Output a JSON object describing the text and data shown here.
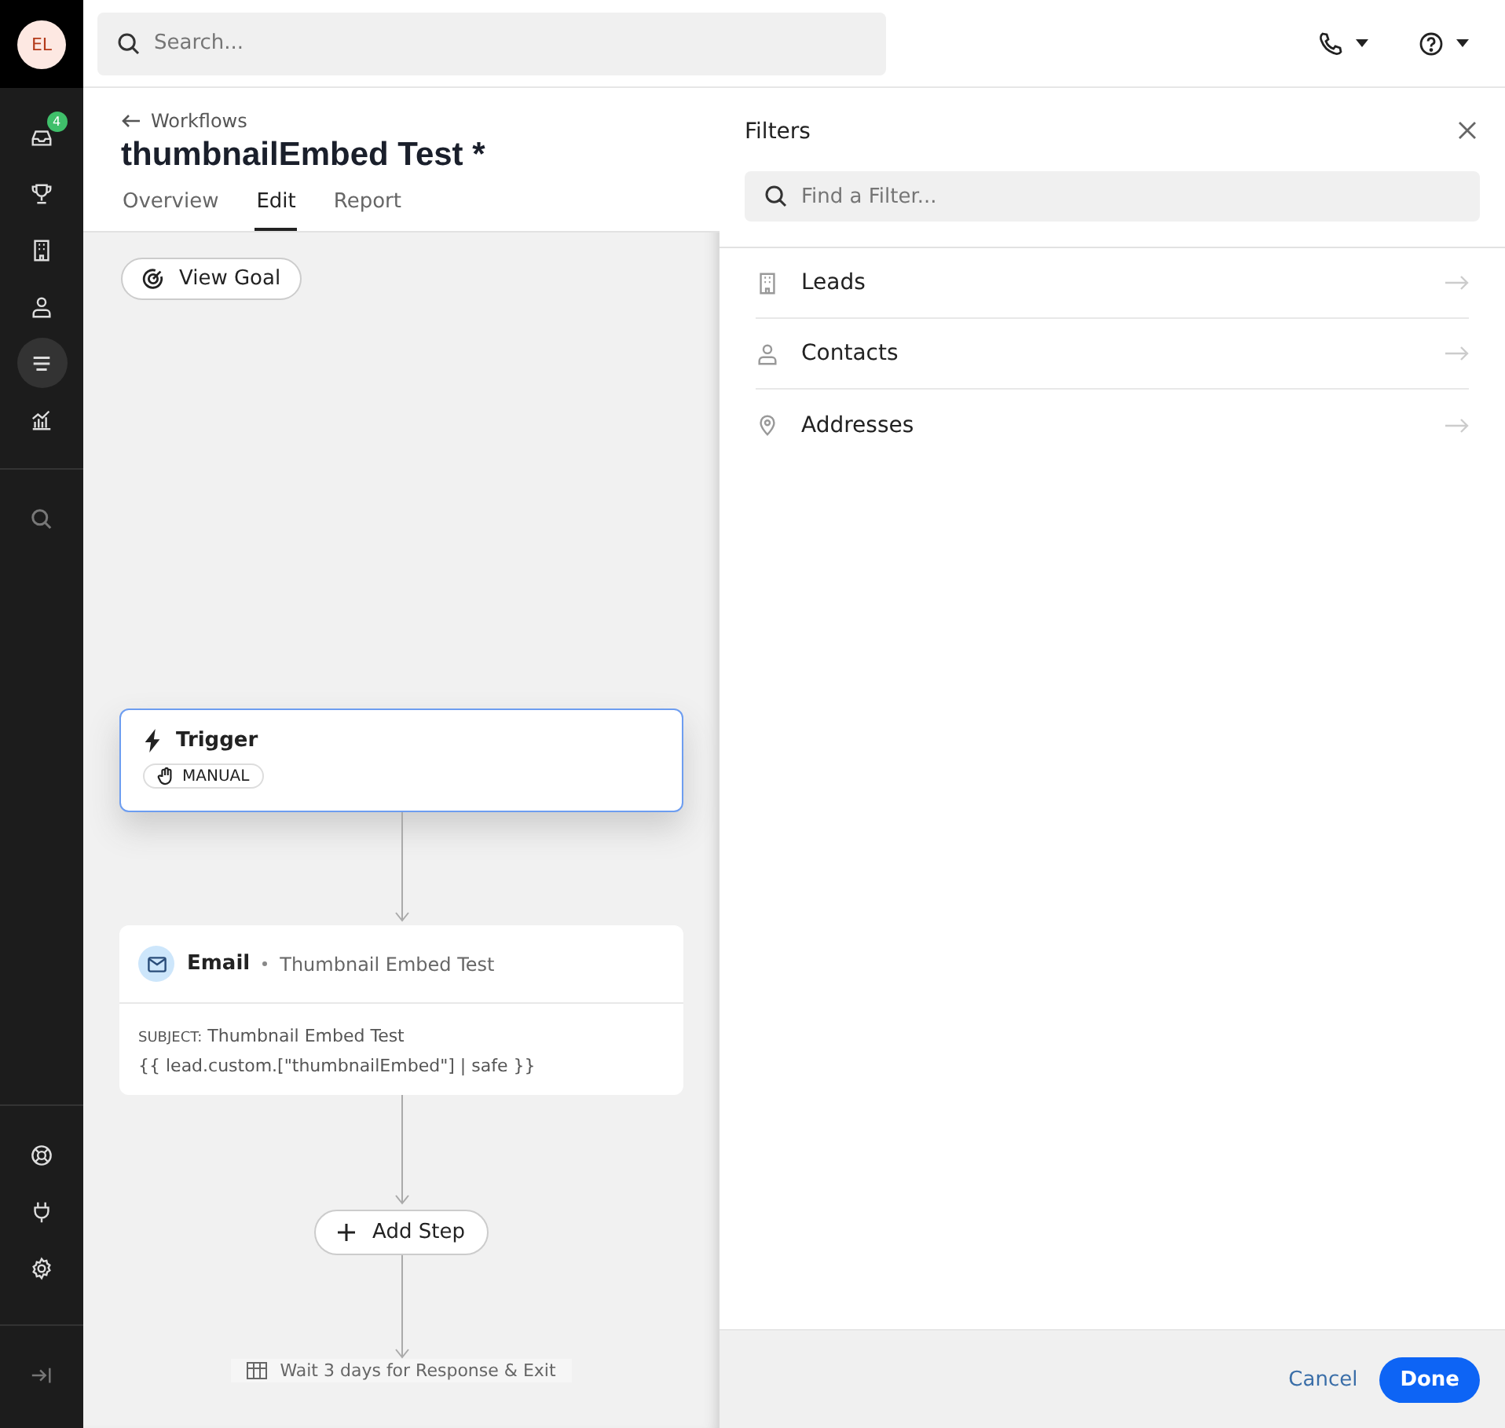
{
  "user": {
    "initials": "EL"
  },
  "search": {
    "placeholder": "Search..."
  },
  "nav": {
    "main": [
      {
        "kind": "inbox",
        "badge": "4",
        "selected": false
      },
      {
        "kind": "trophy",
        "selected": false
      },
      {
        "kind": "building",
        "selected": false
      },
      {
        "kind": "person",
        "selected": false
      },
      {
        "kind": "list",
        "selected": true
      },
      {
        "kind": "chart",
        "selected": false
      }
    ],
    "tools": [
      {
        "kind": "search",
        "selected": false
      }
    ],
    "bottom": [
      {
        "kind": "lifebuoy",
        "selected": false
      },
      {
        "kind": "plug",
        "selected": false
      },
      {
        "kind": "gear",
        "selected": false
      }
    ]
  },
  "breadcrumb": "Workflows",
  "title": "thumbnailEmbed Test *",
  "tabs": [
    {
      "label": "Overview",
      "selected": false
    },
    {
      "label": "Edit",
      "selected": true
    },
    {
      "label": "Report",
      "selected": false
    }
  ],
  "view_goal": "View Goal",
  "trigger": {
    "title": "Trigger",
    "badge": "MANUAL"
  },
  "email": {
    "type": "Email",
    "name": "Thumbnail Embed Test",
    "subject_label": "SUBJECT:",
    "subject": "Thumbnail Embed Test",
    "body": "{{ lead.custom.[\"thumbnailEmbed\"] | safe }}"
  },
  "add_step": "Add Step",
  "next_step": "Wait 3 days for Response & Exit",
  "filters": {
    "title": "Filters",
    "placeholder": "Find a Filter...",
    "items": [
      {
        "kind": "building",
        "label": "Leads"
      },
      {
        "kind": "person",
        "label": "Contacts"
      },
      {
        "kind": "pin",
        "label": "Addresses"
      }
    ],
    "cancel": "Cancel",
    "done": "Done"
  }
}
